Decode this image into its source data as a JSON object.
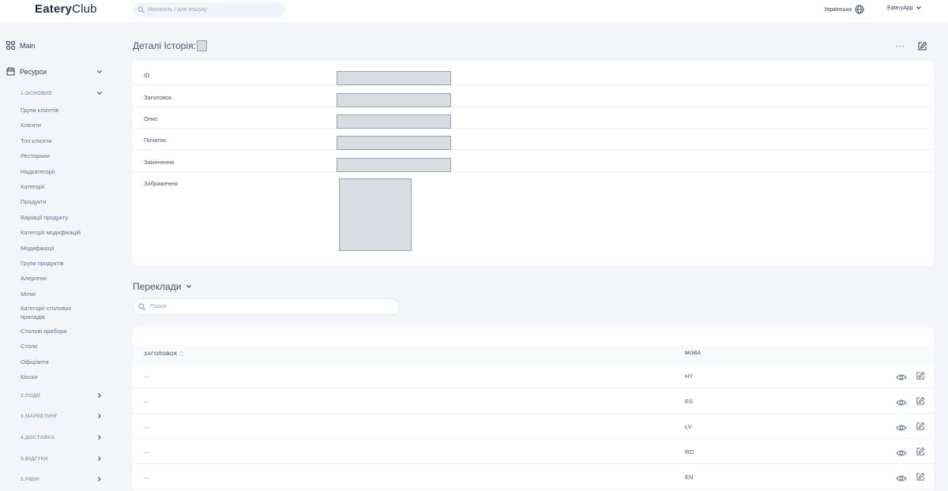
{
  "header": {
    "logo_bold": "Eatery",
    "logo_light": "Club",
    "search_placeholder": "Натисніть / для пошуку",
    "language": "Українська",
    "account": "EateryApp"
  },
  "sidebar": {
    "main_label": "Main",
    "resources_label": "Ресурси",
    "section_basic": "1.ОСНОВНЕ",
    "items": [
      "Групи клієнтів",
      "Клієнти",
      "Топ клієнти",
      "Ресторани",
      "Надкатегорії",
      "Категорії",
      "Продукти",
      "Варіації продукту",
      "Категорії модифікацій",
      "Модифікації",
      "Групи продуктів",
      "Алергени",
      "Мітки",
      "Категорії столових приладів",
      "Столові прибори",
      "Столи",
      "Офіціанти",
      "Кіоски"
    ],
    "sections": [
      "2.ПОДІЇ",
      "3.МАРКЕТИНГ",
      "4.ДОСТАВКА",
      "5.ВІДГУКИ",
      "5.РІВНІ"
    ]
  },
  "detail": {
    "title": "Деталі Історія:",
    "more_label": "···",
    "fields": [
      "ID",
      "Заголовок",
      "Опис",
      "Початок",
      "Закінчення"
    ],
    "image_label": "Зображення"
  },
  "translations": {
    "title": "Переклади",
    "search_placeholder": "Пошук",
    "columns": {
      "title": "ЗАГОЛОВОК",
      "language": "МОВА"
    },
    "rows": [
      {
        "title": "—",
        "language": "HY"
      },
      {
        "title": "—",
        "language": "ES"
      },
      {
        "title": "—",
        "language": "LV"
      },
      {
        "title": "—",
        "language": "RO"
      },
      {
        "title": "—",
        "language": "EN"
      }
    ]
  },
  "icons": {
    "main": "grid-icon",
    "resources": "folder-icon",
    "search": "search-icon",
    "language": "globe-icon",
    "view": "eye-icon",
    "edit": "edit-icon"
  },
  "colors": {
    "background": "#f3f5f9",
    "card": "#ffffff",
    "placeholder_box": "#d9dce1"
  }
}
